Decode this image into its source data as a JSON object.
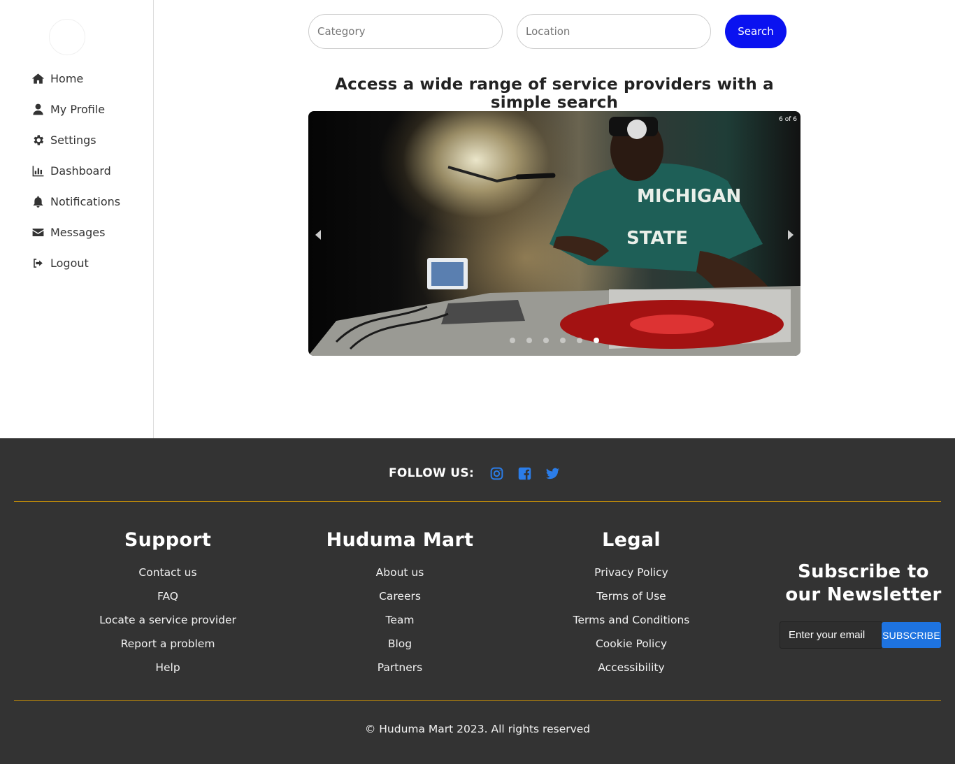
{
  "sidebar": {
    "logo_alt": "logo",
    "items": [
      {
        "label": "Home",
        "icon": "home-icon"
      },
      {
        "label": "My Profile",
        "icon": "user-icon"
      },
      {
        "label": "Settings",
        "icon": "gear-icon"
      },
      {
        "label": "Dashboard",
        "icon": "chart-icon"
      },
      {
        "label": "Notifications",
        "icon": "bell-icon"
      },
      {
        "label": "Messages",
        "icon": "envelope-icon"
      },
      {
        "label": "Logout",
        "icon": "sign-out-icon"
      }
    ]
  },
  "search": {
    "category_placeholder": "Category",
    "location_placeholder": "Location",
    "button_label": "Search",
    "button_color": "#0a12f0"
  },
  "headline": "Access a wide range of service providers with a simple search",
  "slider": {
    "counter": "6 of 6",
    "total": 6,
    "active": 6
  },
  "footer": {
    "follow_label": "FOLLOW US:",
    "social": [
      {
        "name": "instagram-icon",
        "color": "#2b7de9"
      },
      {
        "name": "facebook-icon",
        "color": "#2b7de9"
      },
      {
        "name": "twitter-icon",
        "color": "#2b7de9"
      }
    ],
    "columns": [
      {
        "title": "Support",
        "links": [
          "Contact us",
          "FAQ",
          "Locate a service provider",
          "Report a problem",
          "Help"
        ]
      },
      {
        "title": "Huduma Mart",
        "links": [
          "About us",
          "Careers",
          "Team",
          "Blog",
          "Partners"
        ]
      },
      {
        "title": "Legal",
        "links": [
          "Privacy Policy",
          "Terms of Use",
          "Terms and Conditions",
          "Cookie Policy",
          "Accessibility"
        ]
      }
    ],
    "newsletter": {
      "title": "Subscribe to our Newsletter",
      "placeholder": "Enter your email",
      "button_label": "SUBSCRIBE"
    },
    "copyright": "© Huduma Mart 2023. All rights reserved",
    "background": "#333333",
    "divider_color": "#b8860b"
  }
}
